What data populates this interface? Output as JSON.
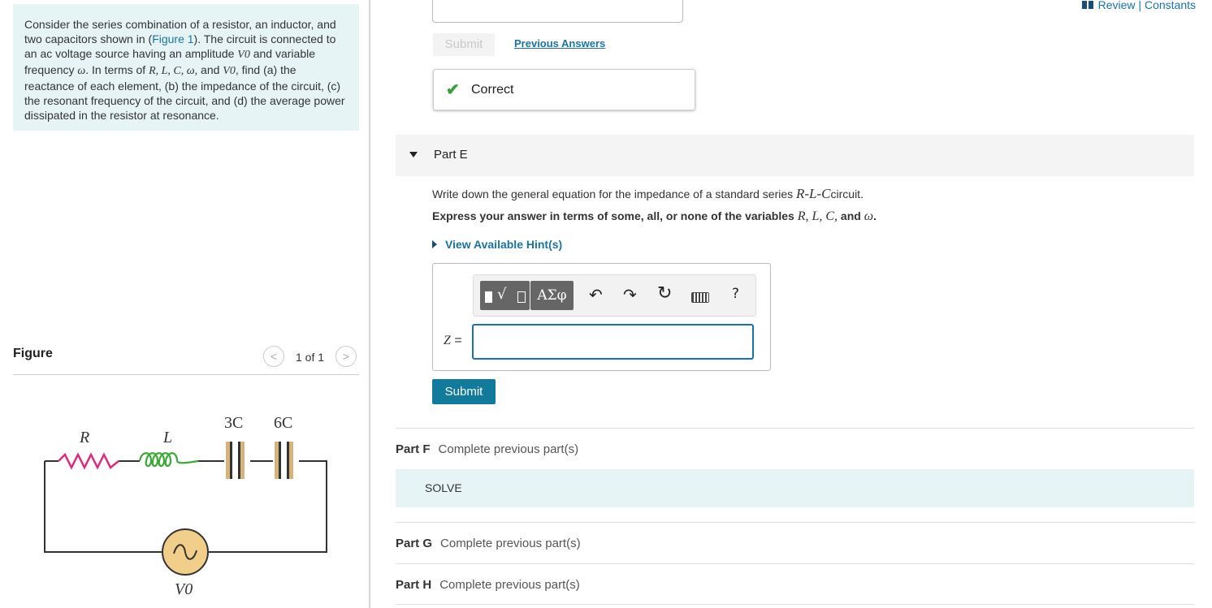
{
  "problem": {
    "text_before_figure": "Consider the series combination of a resistor, an inductor, and two capacitors shown in (",
    "figure_link": "Figure 1",
    "text_after_figure": "). The circuit is connected to an ac voltage source having an amplitude ",
    "v0": "V0",
    "text_2": " and variable frequency ",
    "omega": "ω",
    "text_3": ". In terms of ",
    "vars": "R, L, C, ω,",
    "and_word": " and ",
    "v0b": "V0",
    "text_4": ", find (a) the reactance of each element, (b) the impedance of the circuit, (c) the resonant frequency of the circuit, and (d) the average power dissipated in the resistor at resonance."
  },
  "figure": {
    "label": "Figure",
    "prev_icon": "chevron-left-icon",
    "next_icon": "chevron-right-icon",
    "prev_glyph": "<",
    "next_glyph": ">",
    "count": "1 of 1",
    "labels": {
      "R": "R",
      "L": "L",
      "C1": "3C",
      "C2": "6C",
      "V": "V0"
    },
    "colors": {
      "resistor": "#e0287a",
      "inductor": "#3aa935",
      "capacitor": "#d7b27a",
      "source": "#f1cf8a",
      "wire": "#333333"
    }
  },
  "header": {
    "review_constants": "Review | Constants",
    "book_icon": "book-icon"
  },
  "previous": {
    "submit_label": "Submit",
    "previous_answers": "Previous Answers",
    "correct_label": "Correct",
    "check_icon": "check-icon",
    "check_glyph": "✔"
  },
  "partE": {
    "title": "Part E",
    "question_before": "Write down the general equation for the impedance of a standard series ",
    "question_math": "R-L-C",
    "question_after": "circuit.",
    "express_before": "Express your answer in terms of some, all, or none of the variables ",
    "express_vars": "R, L, C,",
    "express_and": " and ",
    "express_omega": "ω",
    "express_end": ".",
    "hint_label": "View Available Hint(s)",
    "toolbar": {
      "templates_icon": "templates-icon",
      "radical_glyph": "√",
      "greek_label": "ΑΣφ",
      "undo_icon": "undo-icon",
      "undo_glyph": "↶",
      "redo_icon": "redo-icon",
      "redo_glyph": "↷",
      "reset_icon": "reset-icon",
      "reset_glyph": "↻",
      "keyboard_icon": "keyboard-icon",
      "help_label": "?"
    },
    "answer_label": "Z",
    "answer_equals": "=",
    "answer_value": "",
    "submit_label": "Submit"
  },
  "parts": [
    {
      "name": "Part F",
      "status": "Complete previous part(s)"
    },
    {
      "name": "Part G",
      "status": "Complete previous part(s)"
    },
    {
      "name": "Part H",
      "status": "Complete previous part(s)"
    }
  ],
  "solve_label": "SOLVE",
  "colors": {
    "accent": "#127b9c",
    "link": "#1a73a6",
    "panel_bg": "#e6f4f6",
    "correct": "#3a9e3a"
  }
}
